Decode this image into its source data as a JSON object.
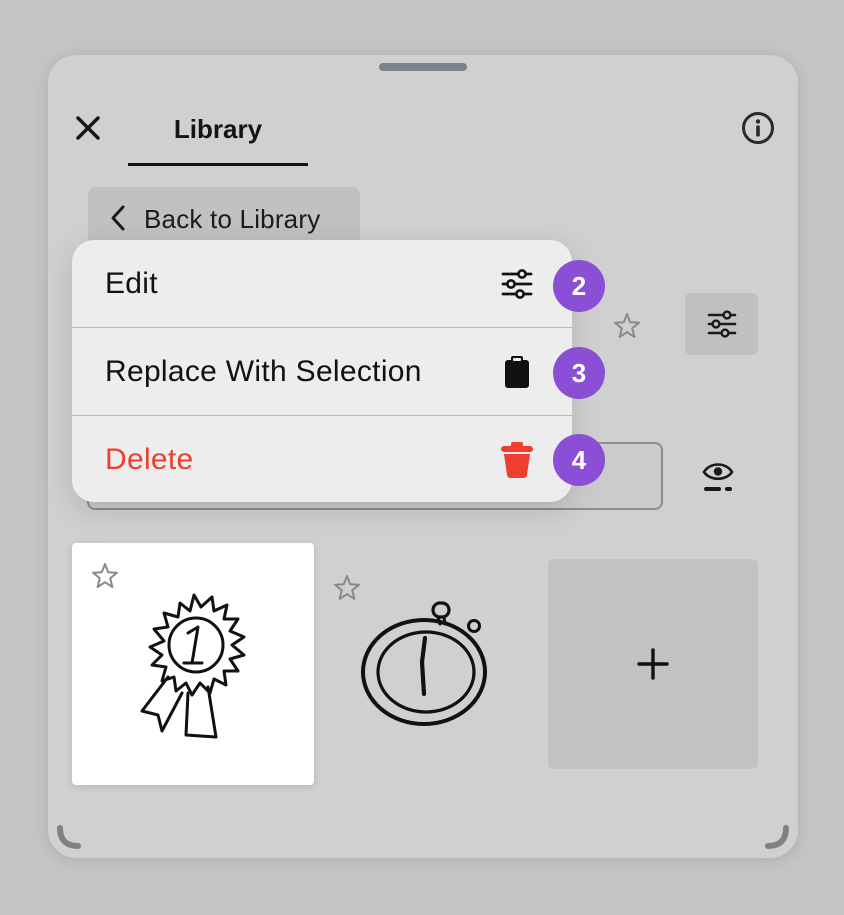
{
  "header": {
    "tab_label": "Library"
  },
  "nav": {
    "back_label": "Back to Library"
  },
  "menu": {
    "items": [
      {
        "label": "Edit",
        "icon": "sliders-icon",
        "badge": "2"
      },
      {
        "label": "Replace With Selection",
        "icon": "clipboard-icon",
        "badge": "3"
      },
      {
        "label": "Delete",
        "icon": "trash-icon",
        "badge": "4"
      }
    ]
  },
  "colors": {
    "accent_badge": "#8b4fd6",
    "danger": "#ef3e2e",
    "panel": "#d0d0d0",
    "menu": "#ededed"
  },
  "grid": {
    "items": [
      {
        "icon": "ribbon-medal-icon",
        "selected": true,
        "favorited": false
      },
      {
        "icon": "stopwatch-icon",
        "selected": false,
        "favorited": false
      }
    ],
    "add_icon": "plus-icon"
  }
}
